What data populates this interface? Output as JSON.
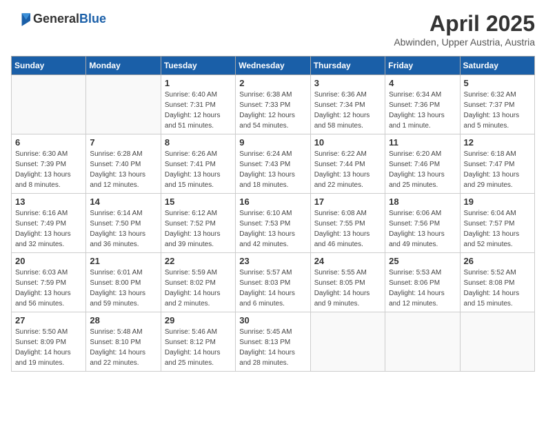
{
  "logo": {
    "text_general": "General",
    "text_blue": "Blue"
  },
  "title": "April 2025",
  "location": "Abwinden, Upper Austria, Austria",
  "weekdays": [
    "Sunday",
    "Monday",
    "Tuesday",
    "Wednesday",
    "Thursday",
    "Friday",
    "Saturday"
  ],
  "weeks": [
    [
      {
        "day": "",
        "info": ""
      },
      {
        "day": "",
        "info": ""
      },
      {
        "day": "1",
        "info": "Sunrise: 6:40 AM\nSunset: 7:31 PM\nDaylight: 12 hours\nand 51 minutes."
      },
      {
        "day": "2",
        "info": "Sunrise: 6:38 AM\nSunset: 7:33 PM\nDaylight: 12 hours\nand 54 minutes."
      },
      {
        "day": "3",
        "info": "Sunrise: 6:36 AM\nSunset: 7:34 PM\nDaylight: 12 hours\nand 58 minutes."
      },
      {
        "day": "4",
        "info": "Sunrise: 6:34 AM\nSunset: 7:36 PM\nDaylight: 13 hours\nand 1 minute."
      },
      {
        "day": "5",
        "info": "Sunrise: 6:32 AM\nSunset: 7:37 PM\nDaylight: 13 hours\nand 5 minutes."
      }
    ],
    [
      {
        "day": "6",
        "info": "Sunrise: 6:30 AM\nSunset: 7:39 PM\nDaylight: 13 hours\nand 8 minutes."
      },
      {
        "day": "7",
        "info": "Sunrise: 6:28 AM\nSunset: 7:40 PM\nDaylight: 13 hours\nand 12 minutes."
      },
      {
        "day": "8",
        "info": "Sunrise: 6:26 AM\nSunset: 7:41 PM\nDaylight: 13 hours\nand 15 minutes."
      },
      {
        "day": "9",
        "info": "Sunrise: 6:24 AM\nSunset: 7:43 PM\nDaylight: 13 hours\nand 18 minutes."
      },
      {
        "day": "10",
        "info": "Sunrise: 6:22 AM\nSunset: 7:44 PM\nDaylight: 13 hours\nand 22 minutes."
      },
      {
        "day": "11",
        "info": "Sunrise: 6:20 AM\nSunset: 7:46 PM\nDaylight: 13 hours\nand 25 minutes."
      },
      {
        "day": "12",
        "info": "Sunrise: 6:18 AM\nSunset: 7:47 PM\nDaylight: 13 hours\nand 29 minutes."
      }
    ],
    [
      {
        "day": "13",
        "info": "Sunrise: 6:16 AM\nSunset: 7:49 PM\nDaylight: 13 hours\nand 32 minutes."
      },
      {
        "day": "14",
        "info": "Sunrise: 6:14 AM\nSunset: 7:50 PM\nDaylight: 13 hours\nand 36 minutes."
      },
      {
        "day": "15",
        "info": "Sunrise: 6:12 AM\nSunset: 7:52 PM\nDaylight: 13 hours\nand 39 minutes."
      },
      {
        "day": "16",
        "info": "Sunrise: 6:10 AM\nSunset: 7:53 PM\nDaylight: 13 hours\nand 42 minutes."
      },
      {
        "day": "17",
        "info": "Sunrise: 6:08 AM\nSunset: 7:55 PM\nDaylight: 13 hours\nand 46 minutes."
      },
      {
        "day": "18",
        "info": "Sunrise: 6:06 AM\nSunset: 7:56 PM\nDaylight: 13 hours\nand 49 minutes."
      },
      {
        "day": "19",
        "info": "Sunrise: 6:04 AM\nSunset: 7:57 PM\nDaylight: 13 hours\nand 52 minutes."
      }
    ],
    [
      {
        "day": "20",
        "info": "Sunrise: 6:03 AM\nSunset: 7:59 PM\nDaylight: 13 hours\nand 56 minutes."
      },
      {
        "day": "21",
        "info": "Sunrise: 6:01 AM\nSunset: 8:00 PM\nDaylight: 13 hours\nand 59 minutes."
      },
      {
        "day": "22",
        "info": "Sunrise: 5:59 AM\nSunset: 8:02 PM\nDaylight: 14 hours\nand 2 minutes."
      },
      {
        "day": "23",
        "info": "Sunrise: 5:57 AM\nSunset: 8:03 PM\nDaylight: 14 hours\nand 6 minutes."
      },
      {
        "day": "24",
        "info": "Sunrise: 5:55 AM\nSunset: 8:05 PM\nDaylight: 14 hours\nand 9 minutes."
      },
      {
        "day": "25",
        "info": "Sunrise: 5:53 AM\nSunset: 8:06 PM\nDaylight: 14 hours\nand 12 minutes."
      },
      {
        "day": "26",
        "info": "Sunrise: 5:52 AM\nSunset: 8:08 PM\nDaylight: 14 hours\nand 15 minutes."
      }
    ],
    [
      {
        "day": "27",
        "info": "Sunrise: 5:50 AM\nSunset: 8:09 PM\nDaylight: 14 hours\nand 19 minutes."
      },
      {
        "day": "28",
        "info": "Sunrise: 5:48 AM\nSunset: 8:10 PM\nDaylight: 14 hours\nand 22 minutes."
      },
      {
        "day": "29",
        "info": "Sunrise: 5:46 AM\nSunset: 8:12 PM\nDaylight: 14 hours\nand 25 minutes."
      },
      {
        "day": "30",
        "info": "Sunrise: 5:45 AM\nSunset: 8:13 PM\nDaylight: 14 hours\nand 28 minutes."
      },
      {
        "day": "",
        "info": ""
      },
      {
        "day": "",
        "info": ""
      },
      {
        "day": "",
        "info": ""
      }
    ]
  ]
}
